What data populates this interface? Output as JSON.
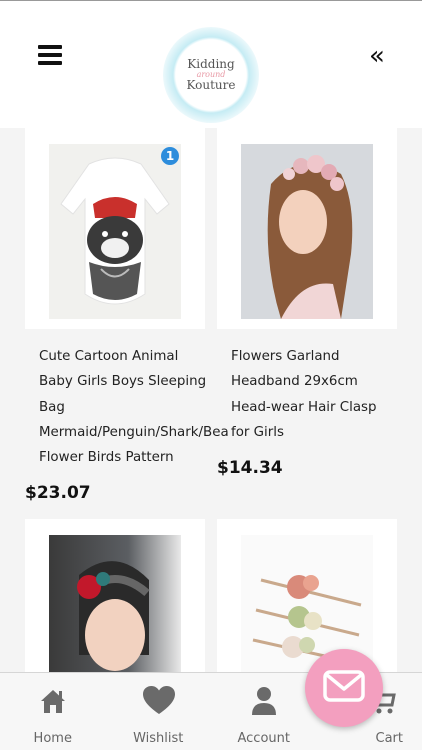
{
  "header": {
    "logo_line1": "Kidding",
    "logo_line2": "around",
    "logo_line3": "Kouture",
    "collapse_glyph": "«"
  },
  "products": [
    {
      "title_lines": [
        "Cute Cartoon Animal",
        "Baby Girls Boys Sleeping",
        "Bag",
        "Mermaid/Penguin/Shark/Bea",
        "Flower Birds Pattern"
      ],
      "price": "$23.07",
      "badge": "1"
    },
    {
      "title_lines": [
        "Flowers Garland",
        "Headband 29x6cm",
        "Head-wear Hair Clasp",
        "for Girls"
      ],
      "price": "$14.34"
    },
    {
      "title_lines": [],
      "price": ""
    },
    {
      "title_lines": [],
      "price": ""
    }
  ],
  "tabbar": {
    "tabs": [
      {
        "label": "Home",
        "icon": "home-icon"
      },
      {
        "label": "Wishlist",
        "icon": "heart-icon"
      },
      {
        "label": "Account",
        "icon": "person-icon"
      },
      {
        "label": "Cart",
        "icon": "cart-icon"
      }
    ]
  },
  "fab": {
    "icon": "mail-icon"
  },
  "colors": {
    "fab": "#f39fbf",
    "badge": "#2d8ddc",
    "tab_icon": "#666666"
  }
}
